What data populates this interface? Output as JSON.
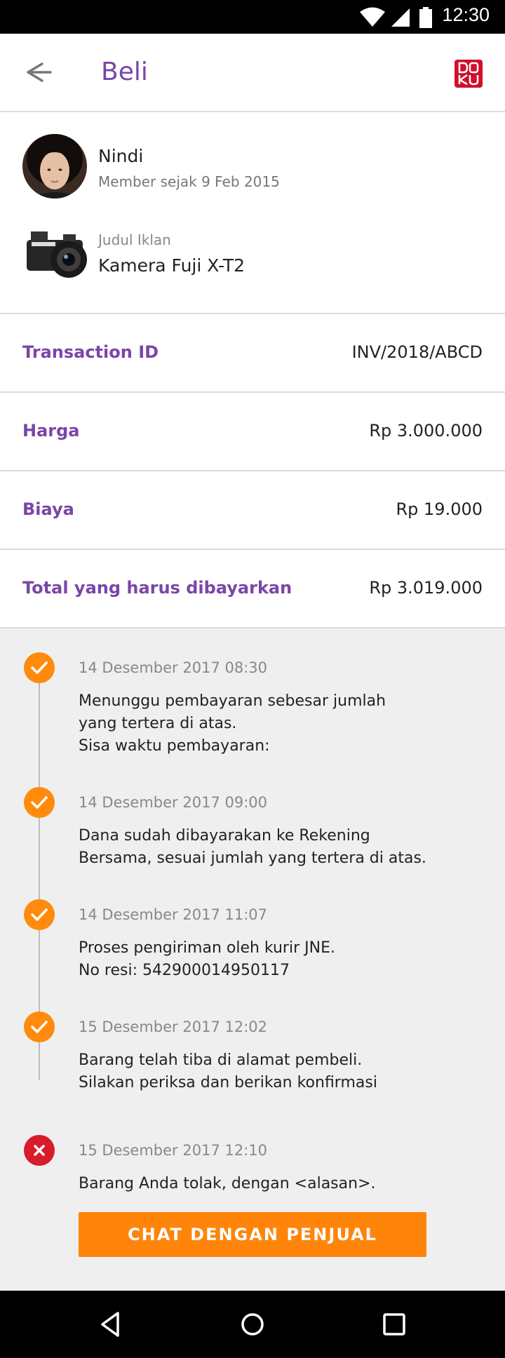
{
  "status_bar": {
    "time": "12:30",
    "icons": [
      "wifi-icon",
      "signal-icon",
      "battery-icon"
    ]
  },
  "app_bar": {
    "title": "Beli",
    "back_icon": "arrow-left-icon",
    "brand_logo": "DO KU"
  },
  "seller": {
    "name": "Nindi",
    "member_since": "Member sejak 9 Feb 2015"
  },
  "listing": {
    "label": "Judul Iklan",
    "title": "Kamera Fuji X-T2"
  },
  "details": [
    {
      "label": "Transaction ID",
      "value": "INV/2018/ABCD"
    },
    {
      "label": "Harga",
      "value": "Rp 3.000.000"
    },
    {
      "label": "Biaya",
      "value": "Rp 19.000"
    },
    {
      "label": "Total yang harus dibayarkan",
      "value": "Rp 3.019.000"
    }
  ],
  "timeline": [
    {
      "status": "done",
      "date": "14 Desember 2017 08:30",
      "lines": [
        "Menunggu pembayaran sebesar jumlah",
        "yang tertera di atas.",
        "Sisa waktu pembayaran:"
      ]
    },
    {
      "status": "done",
      "date": "14 Desember 2017 09:00",
      "lines": [
        "Dana sudah dibayarakan ke Rekening",
        "Bersama, sesuai jumlah yang tertera di atas."
      ]
    },
    {
      "status": "done",
      "date": "14 Desember 2017 11:07",
      "lines": [
        "Proses pengiriman oleh kurir JNE.",
        "No resi: 542900014950117"
      ]
    },
    {
      "status": "done",
      "date": "15 Desember 2017 12:02",
      "lines": [
        "Barang telah tiba di alamat pembeli.",
        "Silakan periksa dan berikan konfirmasi"
      ]
    },
    {
      "status": "rejected",
      "date": "15 Desember 2017 12:10",
      "lines": [
        "Barang Anda tolak, dengan <alasan>."
      ]
    }
  ],
  "chat_button": {
    "label": "CHAT DENGAN PENJUAL"
  },
  "colors": {
    "accent": "#7a46a7",
    "orange": "#ff850a",
    "reject": "#d71c2a",
    "brand": "#d0102b"
  },
  "nav_bar": {
    "icons": [
      "back-triangle-icon",
      "home-circle-icon",
      "recents-square-icon"
    ]
  }
}
